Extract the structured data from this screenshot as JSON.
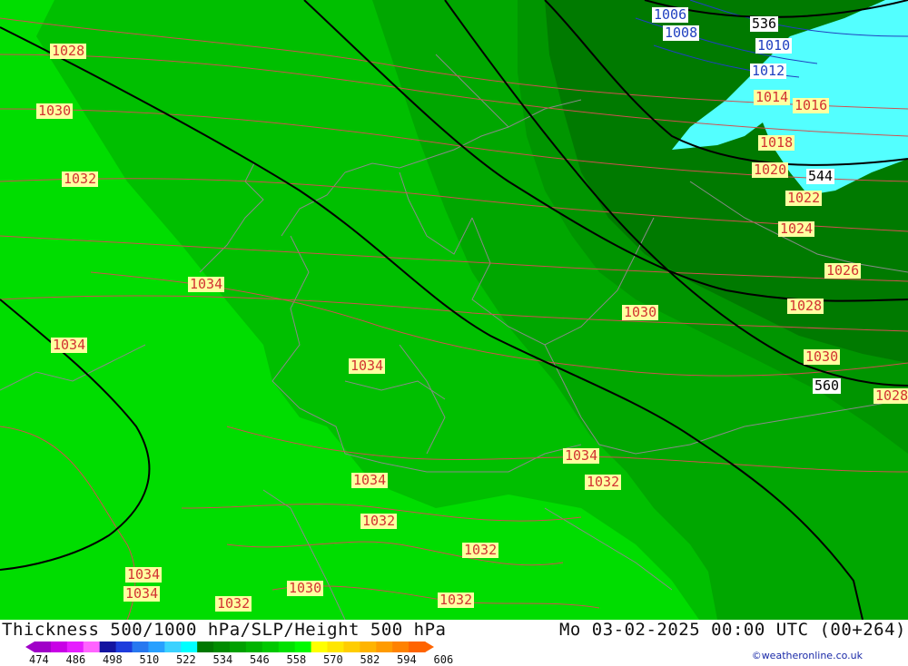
{
  "title": "Thickness 500/1000 hPa/SLP/Height 500 hPa",
  "valid_time": "Mo 03-02-2025 00:00 UTC (00+264)",
  "credit": "©weatheronline.co.uk",
  "colors": {
    "field_light": "#00dd00",
    "field_mid": "#00bf00",
    "field_mid2": "#00a700",
    "field_dark": "#009500",
    "field_darkest": "#007a00",
    "cyan_area": "#53ffff",
    "isobar": "#d05050",
    "height_contour": "#000000",
    "label_bg": "#ffffa0"
  },
  "legend": {
    "ticks": [
      "474",
      "486",
      "498",
      "510",
      "522",
      "534",
      "546",
      "558",
      "570",
      "582",
      "594",
      "606"
    ],
    "colors": [
      "#a000c8",
      "#c800e6",
      "#e61eff",
      "#ff64ff",
      "#1414a0",
      "#1e3cdc",
      "#2878f0",
      "#28a0ff",
      "#3cd2ff",
      "#00ffff",
      "#007800",
      "#008c00",
      "#00a000",
      "#00b400",
      "#00c800",
      "#00e100",
      "#00fa00",
      "#ffff00",
      "#ffe600",
      "#ffcd00",
      "#ffb400",
      "#ff9b00",
      "#ff8200",
      "#ff6400"
    ]
  },
  "isobar_labels": [
    {
      "text": "1006",
      "color": "blue"
    },
    {
      "text": "1008",
      "color": "blue"
    },
    {
      "text": "1010",
      "color": "blue"
    },
    {
      "text": "1012",
      "color": "blue"
    },
    {
      "text": "1014",
      "color": "red"
    },
    {
      "text": "1016",
      "color": "red"
    },
    {
      "text": "1018",
      "color": "red"
    },
    {
      "text": "1020",
      "color": "red"
    },
    {
      "text": "1022",
      "color": "red"
    },
    {
      "text": "1024",
      "color": "red"
    },
    {
      "text": "1026",
      "color": "red"
    },
    {
      "text": "1028",
      "color": "red"
    },
    {
      "text": "1028",
      "color": "red"
    },
    {
      "text": "1028",
      "color": "red"
    },
    {
      "text": "1030",
      "color": "red"
    },
    {
      "text": "1030",
      "color": "red"
    },
    {
      "text": "1030",
      "color": "red"
    },
    {
      "text": "1030",
      "color": "red"
    },
    {
      "text": "1032",
      "color": "red"
    },
    {
      "text": "1032",
      "color": "red"
    },
    {
      "text": "1032",
      "color": "red"
    },
    {
      "text": "1032",
      "color": "red"
    },
    {
      "text": "1032",
      "color": "red"
    },
    {
      "text": "1032",
      "color": "red"
    },
    {
      "text": "1034",
      "color": "red"
    },
    {
      "text": "1034",
      "color": "red"
    },
    {
      "text": "1034",
      "color": "red"
    },
    {
      "text": "1034",
      "color": "red"
    },
    {
      "text": "1034",
      "color": "red"
    },
    {
      "text": "1034",
      "color": "red"
    },
    {
      "text": "1034",
      "color": "red"
    }
  ],
  "height_labels": [
    "536",
    "544",
    "560"
  ]
}
